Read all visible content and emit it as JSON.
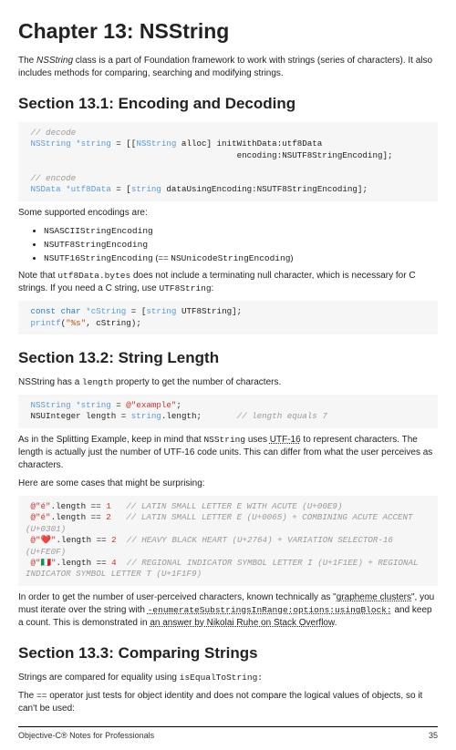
{
  "chapter_title": "Chapter 13: NSString",
  "intro_a": "The ",
  "intro_b": "NSString",
  "intro_c": " class is a part of Foundation framework to work with strings (series of characters). It also includes methods for comparing, searching and modifying strings.",
  "s1_title": "Section 13.1: Encoding and Decoding",
  "s1_after": "Some supported encodings are:",
  "enc1": "NSASCIIStringEncoding",
  "enc2": "NSUTF8StringEncoding",
  "enc3": "NSUTF16StringEncoding",
  "enc3_b": " (== ",
  "enc3_c": "NSUnicodeStringEncoding",
  "enc3_d": ")",
  "note1_a": "Note that ",
  "note1_b": "utf8Data.bytes",
  "note1_c": " does not include a terminating null character, which is necessary for C strings. If you need a C string, use ",
  "note1_d": "UTF8String",
  "note1_e": ":",
  "s2_title": "Section 13.2: String Length",
  "s2_p1_a": "NSString has a ",
  "s2_p1_b": "length",
  "s2_p1_c": " property to get the number of characters.",
  "s2_p2_a": "As in the Splitting Example, keep in mind that ",
  "s2_p2_b": "NSString",
  "s2_p2_c": " uses ",
  "s2_p2_d": "UTF-16",
  "s2_p2_e": " to represent characters. The length is actually just the number of UTF-16 code units. This can differ from what the user perceives as characters.",
  "s2_p3": "Here are some cases that might be surprising:",
  "s2_p4_a": "In order to get the number of user-perceived characters, known technically as \"",
  "s2_p4_b": "grapheme clusters",
  "s2_p4_c": "\", you must iterate over the string with ",
  "s2_p4_d": "-enumerateSubstringsInRange:options:usingBlock:",
  "s2_p4_e": " and keep a count. This is demonstrated in ",
  "s2_p4_f": "an answer by Nikolai Ruhe on Stack Overflow",
  "s2_p4_g": ".",
  "s3_title": "Section 13.3: Comparing Strings",
  "s3_p1_a": "Strings are compared for equality using ",
  "s3_p1_b": "isEqualToString:",
  "s3_p2_a": "The ",
  "s3_p2_b": "==",
  "s3_p2_c": " operator just tests for object identity and does not compare the logical values of objects, so it can't be used:",
  "footer_left": "Objective-C® Notes for Professionals",
  "footer_right": "35",
  "code": {
    "c1_comment1": " // decode",
    "c1_l2a": " NSString",
    "c1_l2b": " *string",
    "c1_l2c": " = [[",
    "c1_l2d": "NSString",
    "c1_l2e": " alloc] initWithData:utf8Data",
    "c1_l3": "                                          encoding:NSUTF8StringEncoding];",
    "c1_comment2": " // encode",
    "c1_l5a": " NSData",
    "c1_l5b": " *utf8Data",
    "c1_l5c": " = [",
    "c1_l5d": "string",
    "c1_l5e": " dataUsingEncoding:NSUTF8StringEncoding];",
    "c2_l1a": " const",
    "c2_l1b": " char",
    "c2_l1c": " *cString",
    "c2_l1d": " = [",
    "c2_l1e": "string",
    "c2_l1f": " UTF8String];",
    "c2_l2a": " printf",
    "c2_l2b": "(",
    "c2_l2c": "\"%s\"",
    "c2_l2d": ", cString);",
    "c3_l1a": " NSString",
    "c3_l1b": " *string",
    "c3_l1c": " = ",
    "c3_l1d": "@\"example\"",
    "c3_l1e": ";",
    "c3_l2a": " NSUInteger length = ",
    "c3_l2b": "string",
    "c3_l2c": ".length;       ",
    "c3_l2d": "// length equals 7",
    "c4_l1a": " @\"é\"",
    "c4_l1b": ".length == ",
    "c4_l1c": "1",
    "c4_l1d": "   // LATIN SMALL LETTER E WITH ACUTE (U+00E9)",
    "c4_l2a": " @\"é\"",
    "c4_l2b": ".length == ",
    "c4_l2c": "2",
    "c4_l2d": "   // LATIN SMALL LETTER E (U+0065) + COMBINING ACUTE ACCENT (U+0301)",
    "c4_l3a": " @\"❤️\"",
    "c4_l3b": ".length == ",
    "c4_l3c": "2",
    "c4_l3d": "  // HEAVY BLACK HEART (U+2764) + VARIATION SELECTOR-16 (U+FE0F)",
    "c4_l4a": " @\"🇮🇹\"",
    "c4_l4b": ".length == ",
    "c4_l4c": "4",
    "c4_l4d": "  // REGIONAL INDICATOR SYMBOL LETTER I (U+1F1EE) + REGIONAL INDICATOR SYMBOL LETTER T (U+1F1F9)"
  }
}
